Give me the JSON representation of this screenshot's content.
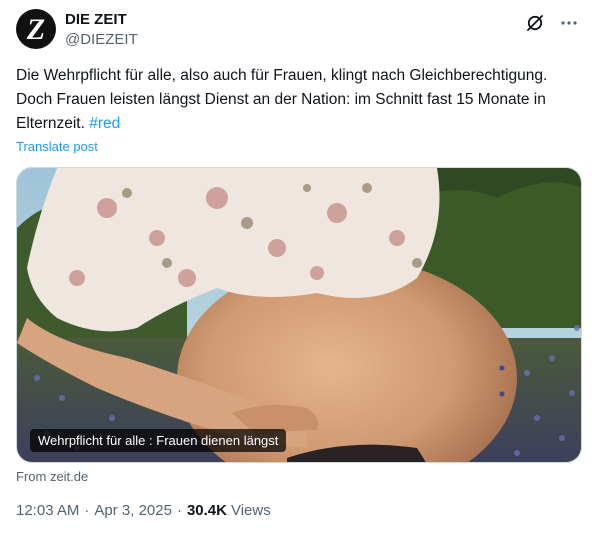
{
  "author": {
    "display_name": "DIE ZEIT",
    "handle": "@DIEZEIT",
    "avatar_letter": "Z"
  },
  "post": {
    "text": "Die Wehrpflicht für alle, also auch für Frauen, klingt nach Gleichberechtigung. Doch Frauen leisten längst Dienst an der Nation: im Schnitt fast 15 Monate in Elternzeit. ",
    "hashtag": "#red",
    "translate_label": "Translate post"
  },
  "media": {
    "caption": "Wehrpflicht für alle : Frauen dienen längst",
    "source": "From zeit.de"
  },
  "meta": {
    "time": "12:03 AM",
    "date": "Apr 3, 2025",
    "views_count": "30.4K",
    "views_label": "Views"
  },
  "icons": {
    "grok": "grok-icon",
    "more": "more-icon"
  },
  "colors": {
    "link": "#1d9bf0",
    "secondary_text": "#536471",
    "primary_text": "#0f1419"
  }
}
